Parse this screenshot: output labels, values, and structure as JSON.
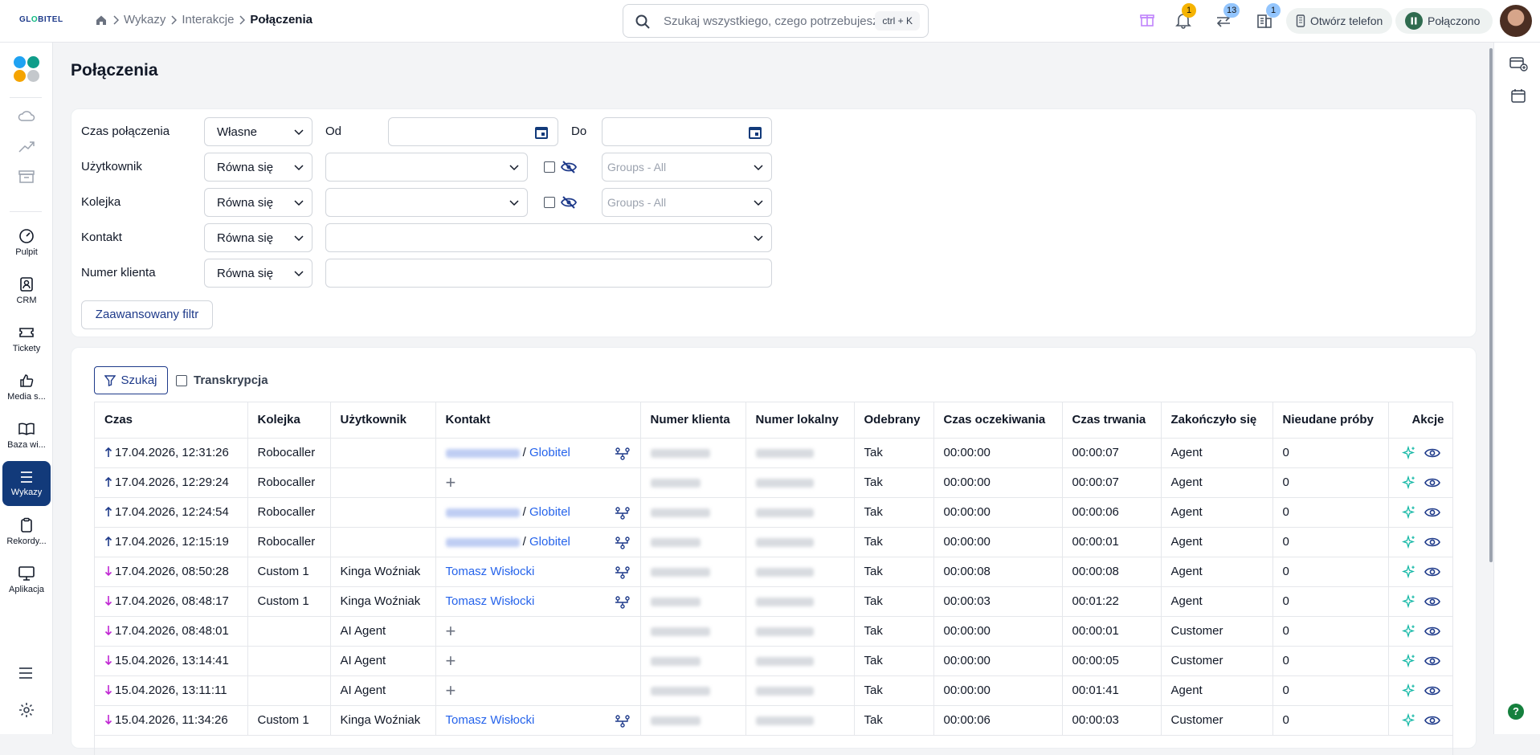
{
  "app": {
    "logo_text": "GL",
    "logo_accent": "O",
    "logo_rest": "BITEL"
  },
  "breadcrumb": [
    "Wykazy",
    "Interakcje",
    "Połączenia"
  ],
  "search": {
    "placeholder": "Szukaj wszystkiego, czego potrzebujesz",
    "shortcut": "ctrl + K"
  },
  "header_badges": {
    "notifications": "1",
    "transfers": "13",
    "queue": "1"
  },
  "header_buttons": {
    "open_phone": "Otwórz telefon",
    "status": "Połączono"
  },
  "sidebar": {
    "items": [
      {
        "label": "Pulpit",
        "icon": "gauge-icon"
      },
      {
        "label": "CRM",
        "icon": "contact-card-icon"
      },
      {
        "label": "Tickety",
        "icon": "ticket-icon"
      },
      {
        "label": "Media s...",
        "icon": "thumbs-up-icon"
      },
      {
        "label": "Baza wi...",
        "icon": "book-icon"
      },
      {
        "label": "Wykazy",
        "icon": "list-icon"
      },
      {
        "label": "Rekordy...",
        "icon": "clipboard-icon"
      },
      {
        "label": "Aplikacja",
        "icon": "monitor-icon"
      }
    ]
  },
  "page": {
    "title": "Połączenia"
  },
  "filters": {
    "call_time": {
      "label": "Czas połączenia",
      "value": "Własne",
      "from_label": "Od",
      "to_label": "Do"
    },
    "user": {
      "label": "Użytkownik",
      "operator": "Równa się",
      "groups_placeholder": "Groups - All"
    },
    "queue": {
      "label": "Kolejka",
      "operator": "Równa się",
      "groups_placeholder": "Groups - All"
    },
    "contact": {
      "label": "Kontakt",
      "operator": "Równa się"
    },
    "client_number": {
      "label": "Numer klienta",
      "operator": "Równa się"
    },
    "advanced_button": "Zaawansowany filtr"
  },
  "table_controls": {
    "search_button": "Szukaj",
    "transcription_label": "Transkrypcja"
  },
  "table": {
    "columns": [
      "Czas",
      "Kolejka",
      "Użytkownik",
      "Kontakt",
      "Numer klienta",
      "Numer lokalny",
      "Odebrany",
      "Czas oczekiwania",
      "Czas trwania",
      "Zakończyło się",
      "Nieudane próby",
      "Akcje"
    ],
    "rows": [
      {
        "dir": "out",
        "time": "17.04.2026, 12:31:26",
        "queue": "Robocaller",
        "user": "",
        "contact": {
          "type": "company",
          "company": "Globitel"
        },
        "answered": "Tak",
        "wait": "00:00:00",
        "duration": "00:00:07",
        "ended": "Agent",
        "failed": "0"
      },
      {
        "dir": "out",
        "time": "17.04.2026, 12:29:24",
        "queue": "Robocaller",
        "user": "",
        "contact": {
          "type": "add"
        },
        "answered": "Tak",
        "wait": "00:00:00",
        "duration": "00:00:07",
        "ended": "Agent",
        "failed": "0"
      },
      {
        "dir": "out",
        "time": "17.04.2026, 12:24:54",
        "queue": "Robocaller",
        "user": "",
        "contact": {
          "type": "company",
          "company": "Globitel"
        },
        "answered": "Tak",
        "wait": "00:00:00",
        "duration": "00:00:06",
        "ended": "Agent",
        "failed": "0"
      },
      {
        "dir": "out",
        "time": "17.04.2026, 12:15:19",
        "queue": "Robocaller",
        "user": "",
        "contact": {
          "type": "company",
          "company": "Globitel"
        },
        "answered": "Tak",
        "wait": "00:00:00",
        "duration": "00:00:01",
        "ended": "Agent",
        "failed": "0"
      },
      {
        "dir": "in",
        "time": "17.04.2026, 08:50:28",
        "queue": "Custom 1",
        "user": "Kinga Woźniak",
        "contact": {
          "type": "person",
          "name": "Tomasz Wisłocki"
        },
        "answered": "Tak",
        "wait": "00:00:08",
        "duration": "00:00:08",
        "ended": "Agent",
        "failed": "0"
      },
      {
        "dir": "in",
        "time": "17.04.2026, 08:48:17",
        "queue": "Custom 1",
        "user": "Kinga Woźniak",
        "contact": {
          "type": "person",
          "name": "Tomasz Wisłocki"
        },
        "answered": "Tak",
        "wait": "00:00:03",
        "duration": "00:01:22",
        "ended": "Agent",
        "failed": "0"
      },
      {
        "dir": "in",
        "time": "17.04.2026, 08:48:01",
        "queue": "",
        "user": "AI Agent",
        "contact": {
          "type": "add"
        },
        "answered": "Tak",
        "wait": "00:00:00",
        "duration": "00:00:01",
        "ended": "Customer",
        "failed": "0"
      },
      {
        "dir": "in",
        "time": "15.04.2026, 13:14:41",
        "queue": "",
        "user": "AI Agent",
        "contact": {
          "type": "add"
        },
        "answered": "Tak",
        "wait": "00:00:00",
        "duration": "00:00:05",
        "ended": "Customer",
        "failed": "0"
      },
      {
        "dir": "in",
        "time": "15.04.2026, 13:11:11",
        "queue": "",
        "user": "AI Agent",
        "contact": {
          "type": "add"
        },
        "answered": "Tak",
        "wait": "00:00:00",
        "duration": "00:01:41",
        "ended": "Agent",
        "failed": "0"
      },
      {
        "dir": "in",
        "time": "15.04.2026, 11:34:26",
        "queue": "Custom 1",
        "user": "Kinga Woźniak",
        "contact": {
          "type": "person",
          "name": "Tomasz Wisłocki"
        },
        "answered": "Tak",
        "wait": "00:00:06",
        "duration": "00:00:03",
        "ended": "Customer",
        "failed": "0"
      }
    ]
  },
  "help": "?",
  "colors": {
    "primary": "#123a7a",
    "link": "#2563eb",
    "teal": "#14b8a6",
    "out_arrow": "#1e3a8a",
    "in_arrow": "#c026d3"
  }
}
